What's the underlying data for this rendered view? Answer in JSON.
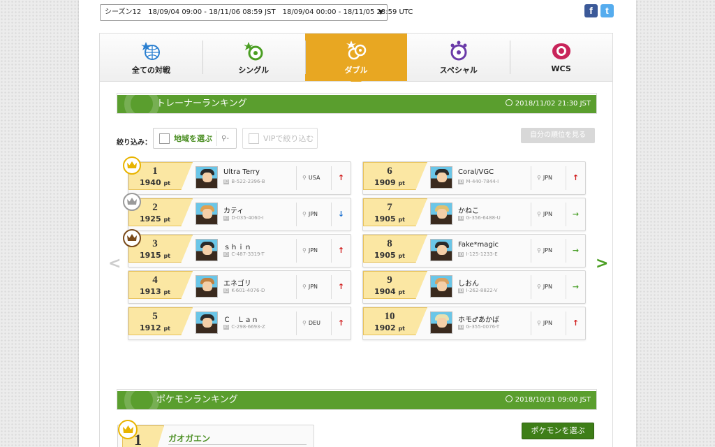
{
  "season": {
    "selected": "シーズン12　18/09/04 09:00 - 18/11/06 08:59 JST　18/09/04 00:00 - 18/11/05 23:59 UTC",
    "arrow": "▼"
  },
  "social": {
    "facebook": "f",
    "twitter": "t"
  },
  "tabs": [
    {
      "label": "全ての対戦",
      "icon": "globe-battle-icon",
      "active": false
    },
    {
      "label": "シングル",
      "icon": "single-battle-icon",
      "active": false
    },
    {
      "label": "ダブル",
      "icon": "double-battle-icon",
      "active": true
    },
    {
      "label": "スペシャル",
      "icon": "special-battle-icon",
      "active": false
    },
    {
      "label": "WCS",
      "icon": "wcs-icon",
      "active": false
    }
  ],
  "trainer_ranking": {
    "title": "トレーナーランキング",
    "timestamp": "2018/11/02 21:30  JST"
  },
  "filter": {
    "label": "絞り込み：",
    "region_button": "地域を選ぶ",
    "region_value": "-",
    "vip_label": "VIPで絞り込む",
    "my_rank_button": "自分の順位を見る"
  },
  "nav": {
    "prev": "<",
    "next": ">"
  },
  "rankings": [
    {
      "rank": "1",
      "points": "1940",
      "unit": "pt",
      "name": "Ultra Terry",
      "id": "B-522-2396-B",
      "country": "USA",
      "trend": "up",
      "medal": "gold"
    },
    {
      "rank": "2",
      "points": "1925",
      "unit": "pt",
      "name": "カティ",
      "id": "D-035-4060-I",
      "country": "JPN",
      "trend": "down",
      "medal": "silver"
    },
    {
      "rank": "3",
      "points": "1915",
      "unit": "pt",
      "name": "ｓｈｉｎ",
      "id": "C-487-3319-T",
      "country": "JPN",
      "trend": "up",
      "medal": "bronze"
    },
    {
      "rank": "4",
      "points": "1913",
      "unit": "pt",
      "name": "エネゴリ",
      "id": "K-601-4076-D",
      "country": "JPN",
      "trend": "up",
      "medal": ""
    },
    {
      "rank": "5",
      "points": "1912",
      "unit": "pt",
      "name": "Ｃ　Ｌａｎ",
      "id": "C-298-6693-Z",
      "country": "DEU",
      "trend": "up",
      "medal": ""
    },
    {
      "rank": "6",
      "points": "1909",
      "unit": "pt",
      "name": "Coral/VGC",
      "id": "M-440-7844-I",
      "country": "JPN",
      "trend": "up",
      "medal": ""
    },
    {
      "rank": "7",
      "points": "1905",
      "unit": "pt",
      "name": "かねこ",
      "id": "G-356-6488-U",
      "country": "JPN",
      "trend": "same",
      "medal": ""
    },
    {
      "rank": "8",
      "points": "1905",
      "unit": "pt",
      "name": "Fake*magic",
      "id": "I-125-1233-E",
      "country": "JPN",
      "trend": "same",
      "medal": ""
    },
    {
      "rank": "9",
      "points": "1904",
      "unit": "pt",
      "name": "しおん",
      "id": "I-262-8822-V",
      "country": "JPN",
      "trend": "same",
      "medal": ""
    },
    {
      "rank": "10",
      "points": "1902",
      "unit": "pt",
      "name": "ホモ♂あかば",
      "id": "G-355-0076-T",
      "country": "JPN",
      "trend": "up",
      "medal": ""
    }
  ],
  "pokemon_ranking": {
    "title": "ポケモンランキング",
    "timestamp": "2018/10/31 09:00  JST",
    "choose_button": "ポケモンを選ぶ",
    "top": {
      "rank": "1",
      "name": "ガオガエン"
    }
  },
  "colors": {
    "accent": "#e8a722",
    "green": "#5a9e2e",
    "plate": "#fbe7a3",
    "up": "#d01818",
    "down": "#1a6fd0",
    "same": "#4aa02a"
  }
}
